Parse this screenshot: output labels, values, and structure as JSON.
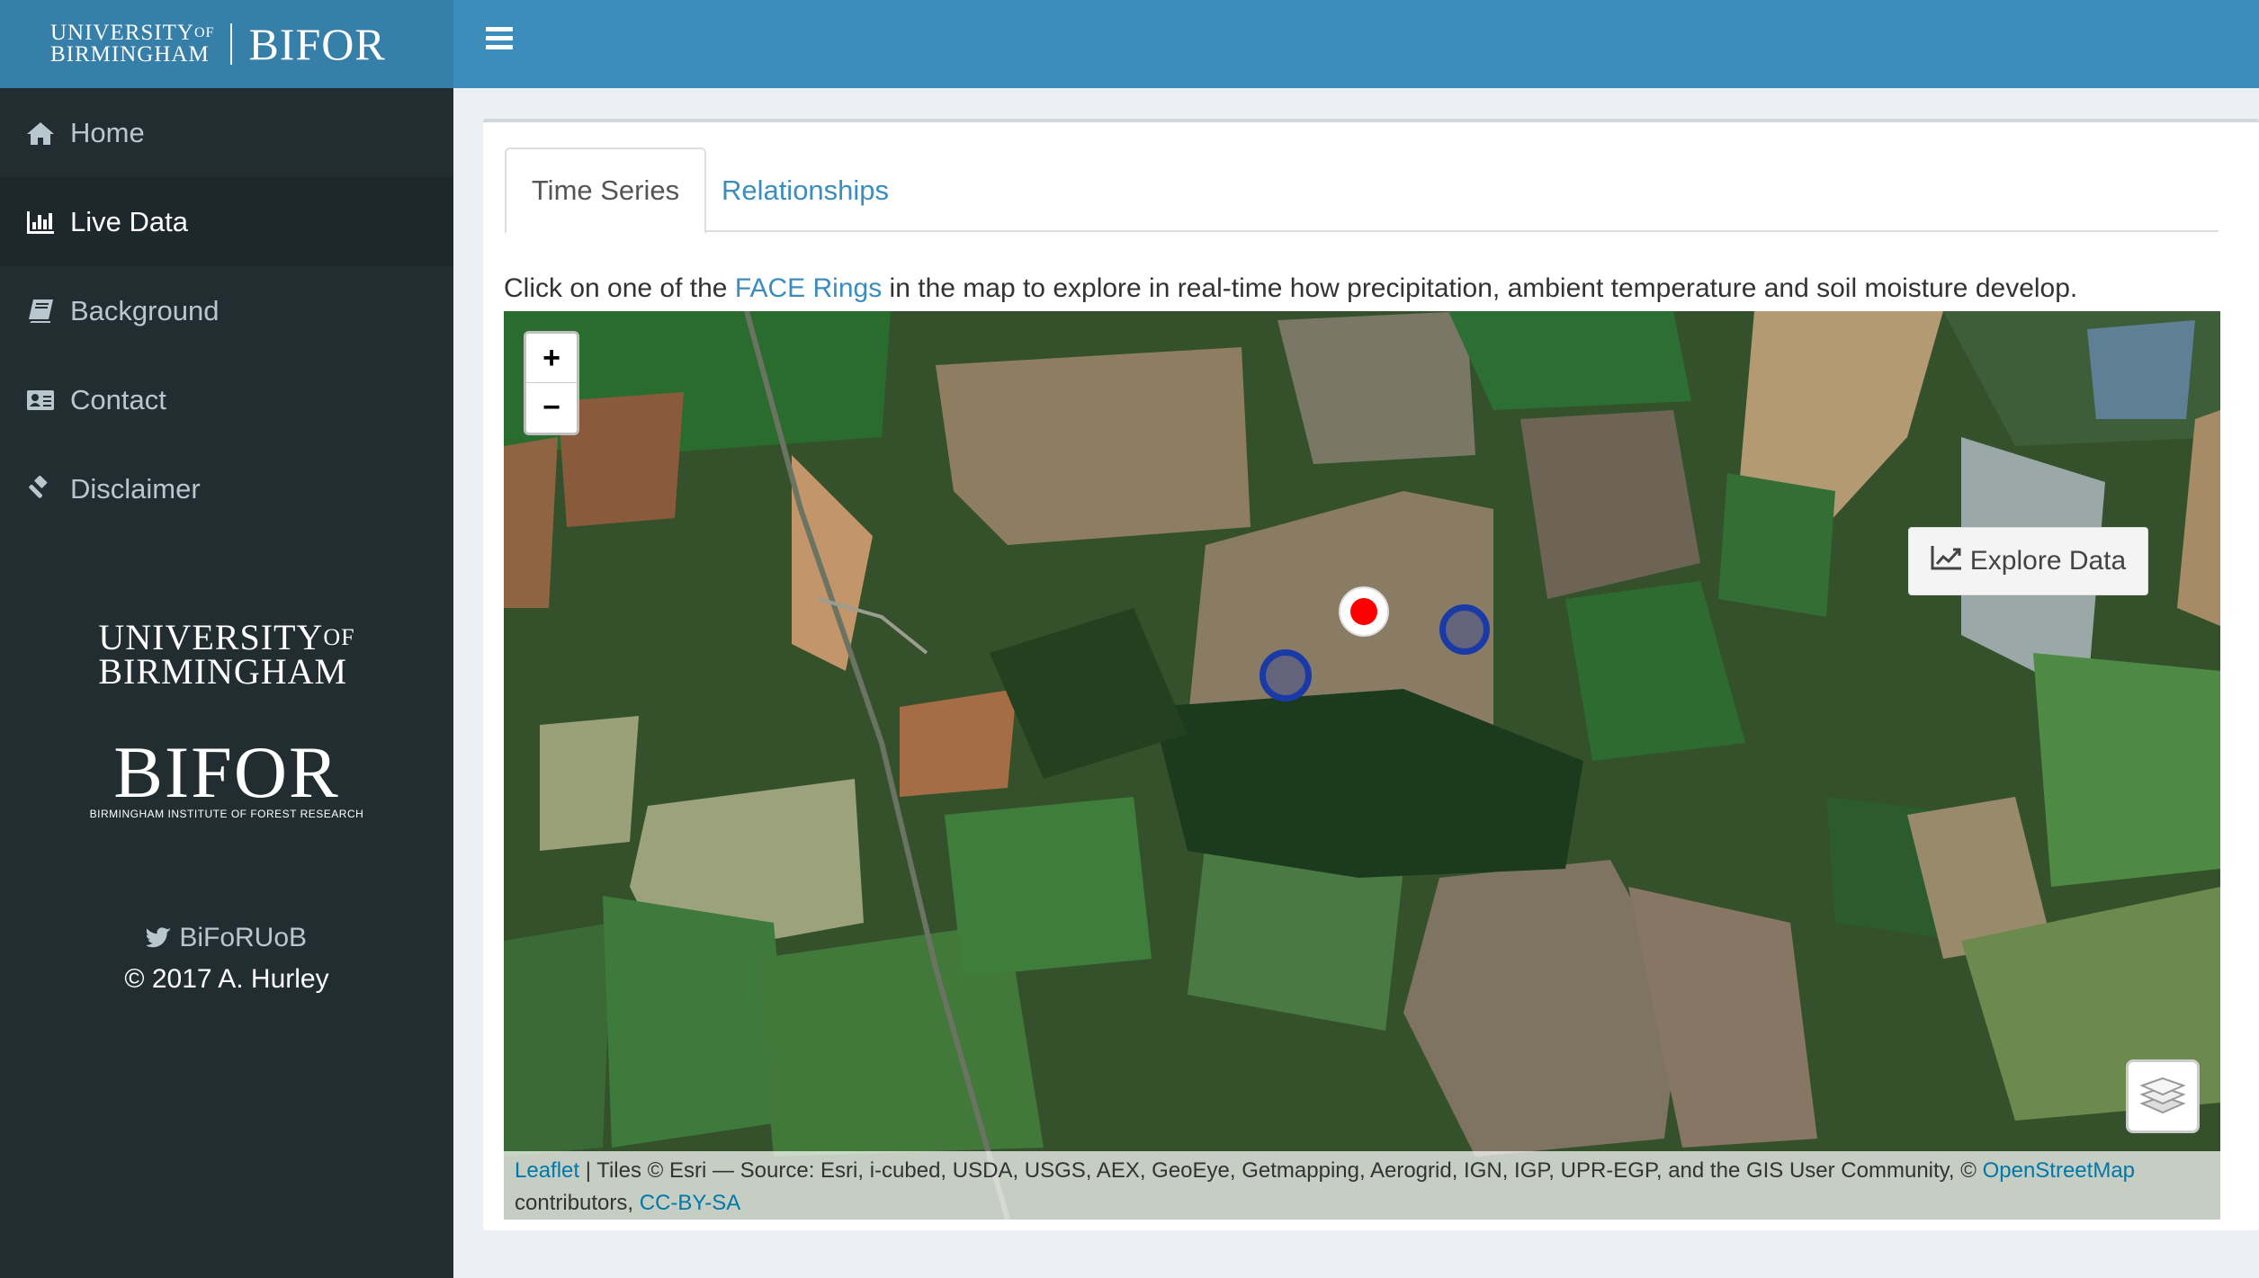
{
  "branding": {
    "university_line1": "UNIVERSITY",
    "university_of": "OF",
    "university_line2": "BIRMINGHAM",
    "bifor": "BIFOR",
    "bifor_subtitle": "BIRMINGHAM INSTITUTE OF FOREST RESEARCH"
  },
  "sidebar": {
    "items": [
      {
        "label": "Home",
        "icon": "home-icon",
        "active": false
      },
      {
        "label": "Live Data",
        "icon": "bar-chart-icon",
        "active": true
      },
      {
        "label": "Background",
        "icon": "book-icon",
        "active": false
      },
      {
        "label": "Contact",
        "icon": "address-card-icon",
        "active": false
      },
      {
        "label": "Disclaimer",
        "icon": "gavel-icon",
        "active": false
      }
    ],
    "twitter": "BiFoRUoB",
    "copyright": "2017 A. Hurley"
  },
  "tabs": [
    {
      "label": "Time Series",
      "active": true
    },
    {
      "label": "Relationships",
      "active": false
    }
  ],
  "intro": {
    "before": "Click on one of the ",
    "link": "FACE Rings",
    "after": " in the map to explore in real-time how precipitation, ambient temperature and soil moisture develop."
  },
  "map": {
    "zoom_in": "+",
    "zoom_out": "−",
    "explore_label": "Explore Data",
    "selected_ring_color": "#ff0000",
    "ring_color": "#1a3aa8",
    "attribution": {
      "leaflet": "Leaflet",
      "tiles": " | Tiles © Esri — Source: Esri, i-cubed, USDA, USGS, AEX, GeoEye, Getmapping, Aerogrid, IGN, IGP, UPR-EGP, and the GIS User Community, © ",
      "osm": "OpenStreetMap",
      "contributors": " contributors, ",
      "license": "CC-BY-SA"
    }
  },
  "colors": {
    "header": "#3c8dbc",
    "sidebar": "#222d32",
    "link": "#3c8dbc"
  }
}
